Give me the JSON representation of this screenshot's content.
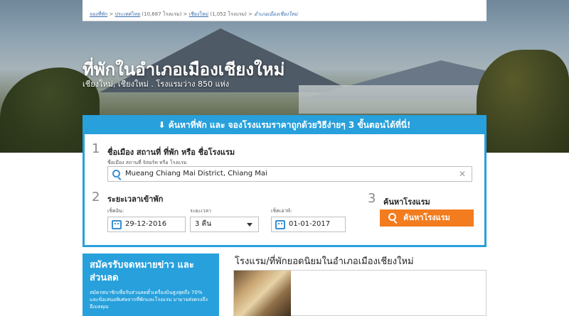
{
  "header": {
    "logo_text": "",
    "breadcrumb": [
      {
        "label": "จองที่พัก"
      },
      {
        "label": "ประเทศไทย",
        "count": "(10,687 โรงแรม)"
      },
      {
        "label": "เชียงใหม่",
        "count": "(1,052 โรงแรม)"
      },
      {
        "label": "อำเภอเมืองเชียงใหม่"
      }
    ]
  },
  "hero": {
    "title": "ที่พักในอำเภอเมืองเชียงใหม่",
    "subtitle": "เชียงใหม่, เชียงใหม่ . โรงแรมว่าง 850 แห่ง"
  },
  "search": {
    "heading": "ค้นหาที่พัก และ จองโรงแรมราคาถูกด้วยวิธีง่ายๆ 3 ขั้นตอนได้ที่นี่!",
    "step1": {
      "number": "1",
      "title": "ชื่อเมือง สถานที่ ที่พัก หรือ ชื่อโรงแรม",
      "field_label": "ชื่อเมือง สถานที่ จิสอร์ท หรือ โรงแรม",
      "value": "Mueang Chiang Mai District, Chiang Mai"
    },
    "step2": {
      "number": "2",
      "title": "ระยะเวลาเข้าพัก",
      "checkin_label": "เช็คอิน:",
      "checkin_value": "29-12-2016",
      "duration_label": "ระยะเวลา",
      "duration_value": "3 คืน",
      "checkout_label": "เช็คเอาท์:",
      "checkout_value": "01-01-2017"
    },
    "step3": {
      "number": "3",
      "title": "ค้นหาโรงแรม",
      "button_label": "ค้นหาโรงแรม"
    }
  },
  "newsletter": {
    "title": "สมัครรับจดหมายข่าว และ ส่วนลด",
    "text": "สมัครสมาชิกเพื่อรับส่วนลดตั๋วเครื่องบินสูงสุดถึง 70% และข้อเสนอพิเศษจากที่พักและโรงแรม มามายส่งตรงถึงอีเมลคุณ"
  },
  "popular": {
    "title": "โรงแรม/ที่พักยอดนิยมในอำเภอเมืองเชียงใหม่"
  },
  "colors": {
    "accent": "#27a0dc",
    "button": "#f27c1e"
  }
}
